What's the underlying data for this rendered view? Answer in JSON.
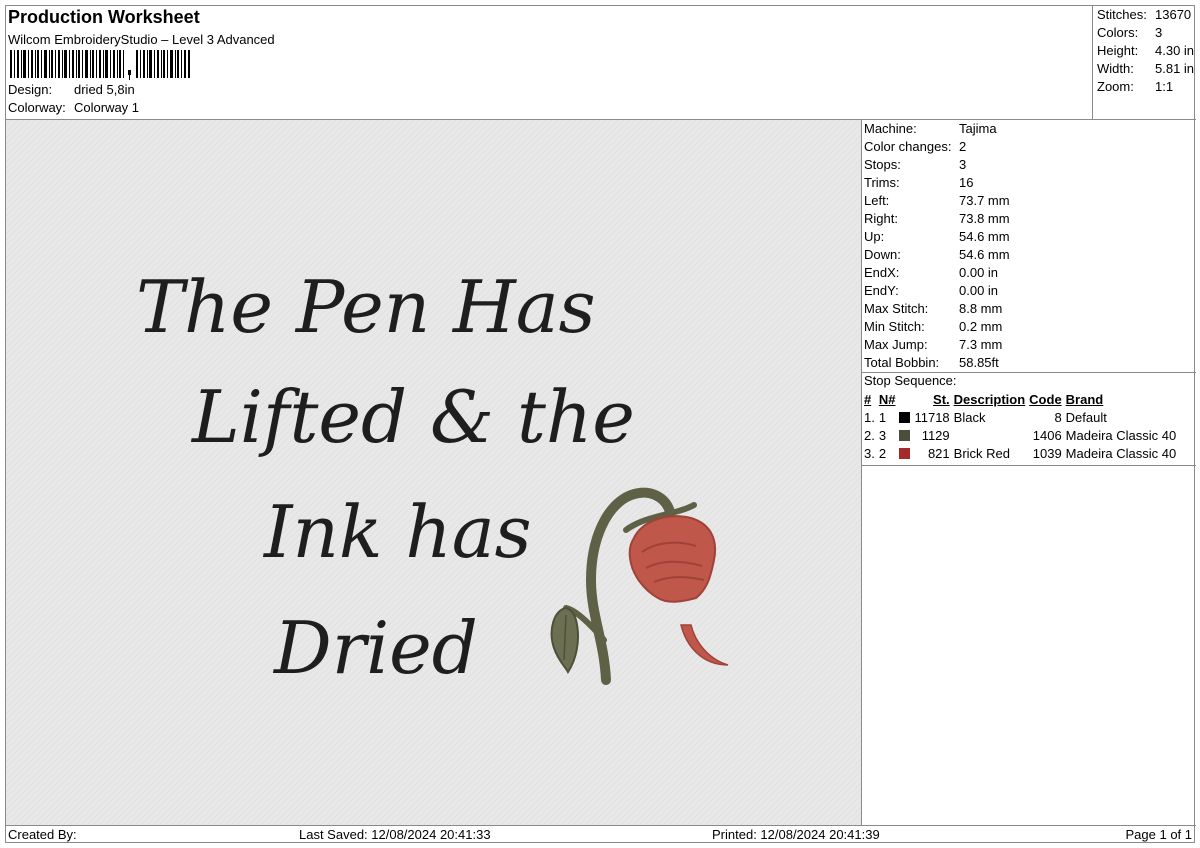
{
  "header": {
    "title": "Production Worksheet",
    "subtitle": "Wilcom EmbroideryStudio – Level 3 Advanced",
    "design_label": "Design:",
    "design_value": "dried 5,8in",
    "colorway_label": "Colorway:",
    "colorway_value": "Colorway 1"
  },
  "summary": [
    {
      "label": "Stitches:",
      "value": "13670"
    },
    {
      "label": "Colors:",
      "value": "3"
    },
    {
      "label": "Height:",
      "value": "4.30 in"
    },
    {
      "label": "Width:",
      "value": "5.81 in"
    },
    {
      "label": "Zoom:",
      "value": "1:1"
    }
  ],
  "design_text": {
    "line1": "The Pen Has",
    "line2": "Lifted & the",
    "line3": "Ink has",
    "line4": "Dried"
  },
  "machine_info": [
    {
      "label": "Machine:",
      "value": "Tajima"
    },
    {
      "label": "Color changes:",
      "value": "2"
    },
    {
      "label": "Stops:",
      "value": "3"
    },
    {
      "label": "Trims:",
      "value": "16"
    },
    {
      "label": "Left:",
      "value": "73.7 mm"
    },
    {
      "label": "Right:",
      "value": "73.8 mm"
    },
    {
      "label": "Up:",
      "value": "54.6 mm"
    },
    {
      "label": "Down:",
      "value": "54.6 mm"
    },
    {
      "label": "EndX:",
      "value": "0.00 in"
    },
    {
      "label": "EndY:",
      "value": "0.00 in"
    },
    {
      "label": "Max Stitch:",
      "value": "8.8 mm"
    },
    {
      "label": "Min Stitch:",
      "value": "0.2 mm"
    },
    {
      "label": "Max Jump:",
      "value": "7.3 mm"
    },
    {
      "label": "Total Bobbin:",
      "value": "58.85ft"
    }
  ],
  "stop_sequence": {
    "title": "Stop Sequence:",
    "headers": [
      "#",
      "N#",
      "St.",
      "Description",
      "Code",
      "Brand"
    ],
    "rows": [
      {
        "num": "1.",
        "n": "1",
        "color": "#000000",
        "st": "11718",
        "desc": "Black",
        "code": "8",
        "brand": "Default"
      },
      {
        "num": "2.",
        "n": "3",
        "color": "#4b4f3a",
        "st": "1129",
        "desc": "",
        "code": "1406",
        "brand": "Madeira Classic 40"
      },
      {
        "num": "3.",
        "n": "2",
        "color": "#a52a2a",
        "st": "821",
        "desc": "Brick Red",
        "code": "1039",
        "brand": "Madeira Classic 40"
      }
    ]
  },
  "footer": {
    "created_by": "Created By:",
    "last_saved": "Last Saved: 12/08/2024 20:41:33",
    "printed": "Printed: 12/08/2024 20:41:39",
    "page": "Page 1 of 1"
  },
  "colors": {
    "text_thread": "#1e1e1e",
    "stem_thread": "#5f6147",
    "rose_thread": "#c0574b",
    "canvas_bg": "#e8e8e8"
  }
}
